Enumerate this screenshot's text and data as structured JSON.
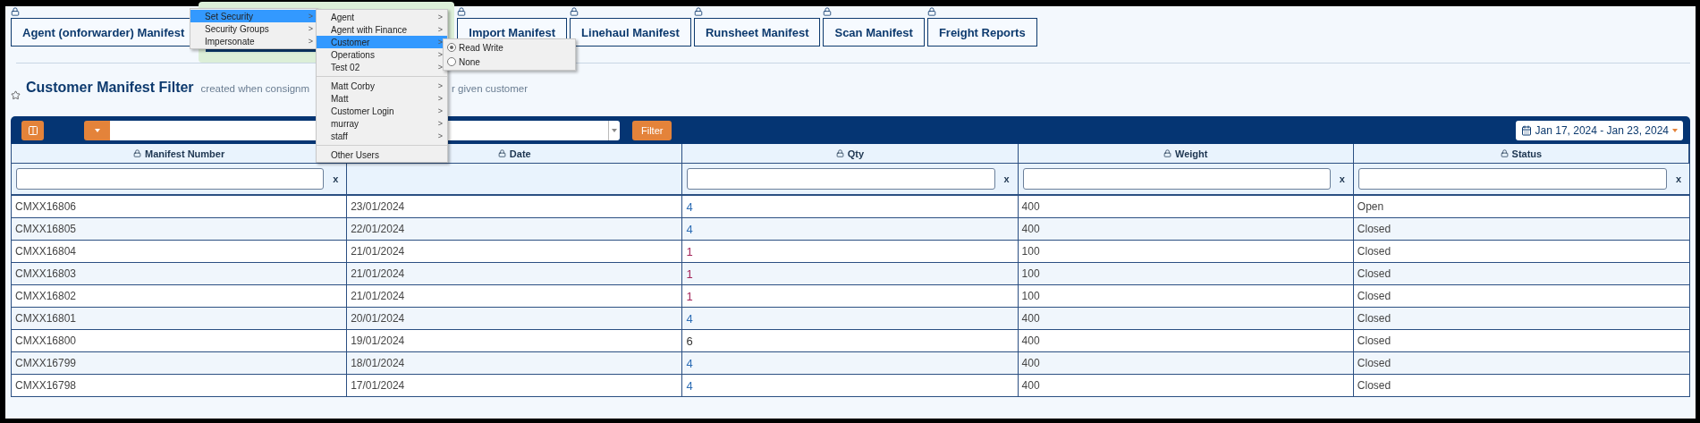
{
  "tabs": [
    {
      "label": "Agent (onforwarder) Manifest",
      "selected": false
    },
    {
      "selected": true
    },
    {
      "label": "Import Manifest",
      "selected": false
    },
    {
      "label": "Linehaul Manifest",
      "selected": false
    },
    {
      "label": "Runsheet Manifest",
      "selected": false
    },
    {
      "label": "Scan Manifest",
      "selected": false
    },
    {
      "label": "Freight Reports",
      "selected": false
    }
  ],
  "heading": {
    "title": "Customer Manifest Filter",
    "subtitle_parts": [
      "created when consignm",
      "r given customer"
    ]
  },
  "toolbar": {
    "filter_button": "Filter",
    "date_range": "Jan 17, 2024 - Jan 23, 2024"
  },
  "table": {
    "columns": [
      "Manifest Number",
      "Date",
      "Qty",
      "Weight",
      "Status"
    ],
    "filters": [
      {
        "kind": "input",
        "clear": "x"
      },
      {
        "kind": "none"
      },
      {
        "kind": "input",
        "clear": "x"
      },
      {
        "kind": "input",
        "clear": "x"
      },
      {
        "kind": "input",
        "clear": "x"
      }
    ],
    "rows": [
      {
        "manifest_number": "CMXX16806",
        "date": "23/01/2024",
        "qty": {
          "text": "4",
          "color": "#2d6db5"
        },
        "weight": "400",
        "status": "Open"
      },
      {
        "manifest_number": "CMXX16805",
        "date": "22/01/2024",
        "qty": {
          "text": "4",
          "color": "#2d6db5"
        },
        "weight": "400",
        "status": "Closed"
      },
      {
        "manifest_number": "CMXX16804",
        "date": "21/01/2024",
        "qty": {
          "text": "1",
          "color": "#a3245a"
        },
        "weight": "100",
        "status": "Closed"
      },
      {
        "manifest_number": "CMXX16803",
        "date": "21/01/2024",
        "qty": {
          "text": "1",
          "color": "#a3245a"
        },
        "weight": "100",
        "status": "Closed"
      },
      {
        "manifest_number": "CMXX16802",
        "date": "21/01/2024",
        "qty": {
          "text": "1",
          "color": "#a3245a"
        },
        "weight": "100",
        "status": "Closed"
      },
      {
        "manifest_number": "CMXX16801",
        "date": "20/01/2024",
        "qty": {
          "text": "4",
          "color": "#2d6db5"
        },
        "weight": "400",
        "status": "Closed"
      },
      {
        "manifest_number": "CMXX16800",
        "date": "19/01/2024",
        "qty": {
          "text": "6",
          "color": "#333333"
        },
        "weight": "400",
        "status": "Closed"
      },
      {
        "manifest_number": "CMXX16799",
        "date": "18/01/2024",
        "qty": {
          "text": "4",
          "color": "#2d6db5"
        },
        "weight": "400",
        "status": "Closed"
      },
      {
        "manifest_number": "CMXX16798",
        "date": "17/01/2024",
        "qty": {
          "text": "4",
          "color": "#2d6db5"
        },
        "weight": "400",
        "status": "Closed"
      }
    ]
  },
  "context_menu": {
    "items": [
      {
        "kind": "item",
        "label": "Set Security",
        "arrow": ">",
        "selected": true
      },
      {
        "kind": "item",
        "label": "Security Groups",
        "arrow": ">",
        "selected": false
      },
      {
        "kind": "item",
        "label": "Impersonate",
        "arrow": ">",
        "selected": false
      }
    ]
  },
  "security_submenu": {
    "items": [
      {
        "kind": "item",
        "label": "Agent",
        "arrow": ">",
        "selected": false
      },
      {
        "kind": "item",
        "label": "Agent with Finance",
        "arrow": ">",
        "selected": false
      },
      {
        "kind": "item",
        "label": "Customer",
        "arrow": ">",
        "selected": true
      },
      {
        "kind": "item",
        "label": "Operations",
        "arrow": ">",
        "selected": false
      },
      {
        "kind": "item",
        "label": "Test 02",
        "arrow": ">",
        "selected": false
      },
      {
        "kind": "separator"
      },
      {
        "kind": "item",
        "label": "Matt Corby",
        "arrow": ">",
        "selected": false
      },
      {
        "kind": "item",
        "label": "Matt",
        "arrow": ">",
        "selected": false
      },
      {
        "kind": "item",
        "label": "Customer Login",
        "arrow": ">",
        "selected": false
      },
      {
        "kind": "item",
        "label": "murray",
        "arrow": ">",
        "selected": false
      },
      {
        "kind": "item",
        "label": "staff",
        "arrow": ">",
        "selected": false
      },
      {
        "kind": "separator"
      },
      {
        "kind": "item",
        "label": "Other Users",
        "selected": false
      }
    ]
  },
  "access_submenu": {
    "options": [
      {
        "label": "Read Write",
        "checked": true
      },
      {
        "label": "None",
        "checked": false
      }
    ]
  }
}
